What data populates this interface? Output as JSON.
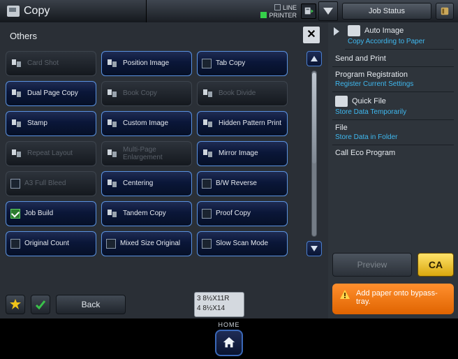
{
  "header": {
    "title": "Copy",
    "indicators": [
      {
        "label": "LINE",
        "on": false
      },
      {
        "label": "PRINTER",
        "on": true
      }
    ],
    "job_status_label": "Job Status"
  },
  "section_title": "Others",
  "options": [
    {
      "label": "Card Shot",
      "enabled": false,
      "kind": "icon"
    },
    {
      "label": "Position Image",
      "enabled": true,
      "kind": "icon"
    },
    {
      "label": "Tab Copy",
      "enabled": true,
      "kind": "check"
    },
    {
      "label": "Dual Page Copy",
      "enabled": true,
      "kind": "icon"
    },
    {
      "label": "Book Copy",
      "enabled": false,
      "kind": "icon"
    },
    {
      "label": "Book Divide",
      "enabled": false,
      "kind": "icon"
    },
    {
      "label": "Stamp",
      "enabled": true,
      "kind": "icon"
    },
    {
      "label": "Custom Image",
      "enabled": true,
      "kind": "icon"
    },
    {
      "label": "Hidden Pattern Print",
      "enabled": true,
      "kind": "icon"
    },
    {
      "label": "Repeat Layout",
      "enabled": false,
      "kind": "icon"
    },
    {
      "label": "Multi-Page Enlargement",
      "enabled": false,
      "kind": "icon"
    },
    {
      "label": "Mirror Image",
      "enabled": true,
      "kind": "icon"
    },
    {
      "label": "A3 Full Bleed",
      "enabled": false,
      "kind": "check"
    },
    {
      "label": "Centering",
      "enabled": true,
      "kind": "icon"
    },
    {
      "label": "B/W Reverse",
      "enabled": true,
      "kind": "check"
    },
    {
      "label": "Job Build",
      "enabled": true,
      "kind": "check",
      "checked": true
    },
    {
      "label": "Tandem Copy",
      "enabled": true,
      "kind": "icon"
    },
    {
      "label": "Proof Copy",
      "enabled": true,
      "kind": "check"
    },
    {
      "label": "Original Count",
      "enabled": true,
      "kind": "check"
    },
    {
      "label": "Mixed Size Original",
      "enabled": true,
      "kind": "check"
    },
    {
      "label": "Slow Scan Mode",
      "enabled": true,
      "kind": "check"
    }
  ],
  "right_panel": [
    {
      "title": "Auto Image",
      "sub": "Copy According to Paper",
      "icon": true
    },
    {
      "title": "Send and Print",
      "sub": "",
      "icon": false
    },
    {
      "title": "Program Registration",
      "sub": "Register Current Settings",
      "icon": false
    },
    {
      "title": "Quick File",
      "sub": "Store Data Temporarily",
      "icon": true
    },
    {
      "title": "File",
      "sub": "Store Data in Folder",
      "icon": false
    },
    {
      "title": "Call Eco Program",
      "sub": "",
      "icon": false
    }
  ],
  "preview_label": "Preview",
  "ca_label": "CA",
  "alert_text": "Add paper onto bypass-tray.",
  "back_label": "Back",
  "tray_lines": [
    "3 8½X11R",
    "4 8½X14"
  ],
  "home_label": "HOME"
}
